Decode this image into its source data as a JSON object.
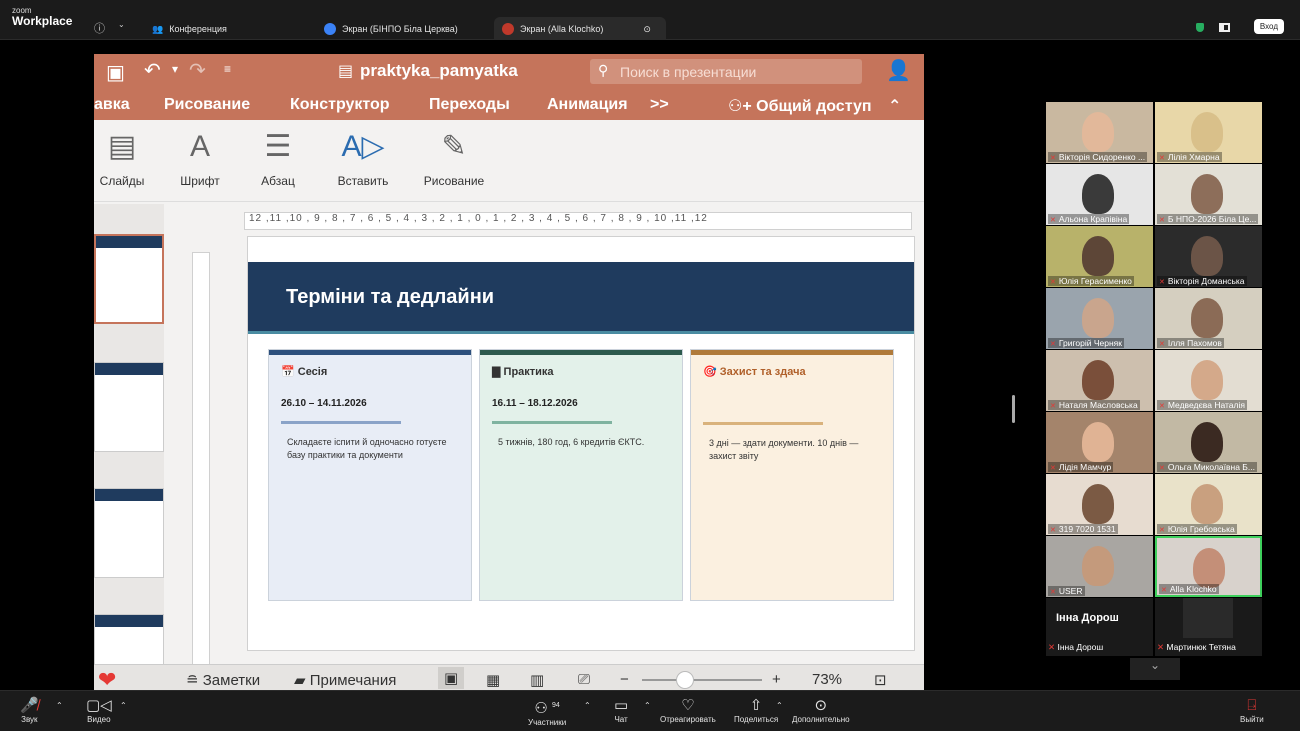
{
  "topbar": {
    "logo_small": "zoom",
    "logo_big": "Workplace",
    "tabs": [
      {
        "label": "Конференция"
      },
      {
        "label": "Экран (БІНПО Біла Церква)"
      },
      {
        "label": "Экран (Alla Klochko)"
      }
    ],
    "signin_label": "Вход"
  },
  "ppt": {
    "filename": "praktyka_pamyatka",
    "search_placeholder": "Поиск в презентации",
    "tabs": [
      "авка",
      "Рисование",
      "Конструктор",
      "Переходы",
      "Анимация",
      ">>"
    ],
    "share_label": "Общий доступ",
    "tools": [
      "Слайды",
      "Шрифт",
      "Абзац",
      "Вставить",
      "Рисование"
    ],
    "ruler_text": "12 ,11 ,10 , 9 , 8 , 7 , 6 , 5 , 4 , 3 , 2 , 1 , 0 , 1 , 2 , 3 , 4 , 5 , 6 , 7 , 8 , 9 , 10 ,11 ,12",
    "slide": {
      "title": "Терміни та дедлайни",
      "cards": [
        {
          "icon": "📅",
          "title": "Сесія",
          "dates": "26.10 – 14.11.2026",
          "text": "Складаєте іспити й одночасно готуєте базу практики та документи",
          "bar": "#2c4f7c",
          "bg": "#e8edf6",
          "line": "#8aa3c8"
        },
        {
          "icon": "▇",
          "title": "Практика",
          "dates": "16.11 – 18.12.2026",
          "text": "5 тижнів, 180 год, 6 кредитів ЄКТС.",
          "bar": "#2d5a4e",
          "bg": "#e3f1ea",
          "line": "#7fb3a0"
        },
        {
          "icon": "🎯",
          "title": "Захист та здача",
          "dates": "",
          "text": "3 дні — здати документи. 10 днів — захист звіту",
          "bar": "#b07a3a",
          "bg": "#fbf0e0",
          "line": "#d9b27c"
        }
      ]
    },
    "status": {
      "notes": "Заметки",
      "comments": "Примечания",
      "zoom": "73%"
    }
  },
  "participants": [
    {
      "name": "Вікторія Сидоренко ..."
    },
    {
      "name": "Лілія Хмарна"
    },
    {
      "name": "Альона Крапівіна"
    },
    {
      "name": "Б НПО-2026 Біла Це..."
    },
    {
      "name": "Юлія Герасименко"
    },
    {
      "name": "Вікторія Доманська"
    },
    {
      "name": "Григорій Черняк"
    },
    {
      "name": "Ілля Пахомов"
    },
    {
      "name": "Наталя Масловська"
    },
    {
      "name": "Медведєва Наталія"
    },
    {
      "name": "Лідія Мамчур"
    },
    {
      "name": "Ольга Миколаївна Б..."
    },
    {
      "name": "319 7020 1531"
    },
    {
      "name": "Юлія Гребовська"
    },
    {
      "name": "USER"
    },
    {
      "name": "Alla Klochko"
    }
  ],
  "participants_extra": {
    "big_name": "Інна Дорош",
    "names": [
      "Інна Дорош",
      "Мартинюк Тетяна"
    ]
  },
  "bottombar": {
    "audio": "Звук",
    "video": "Видео",
    "participants": "Участники",
    "participants_count": "94",
    "chat": "Чат",
    "react": "Отреагировать",
    "share": "Поделиться",
    "more": "Дополнительно",
    "leave": "Выйти"
  },
  "colors": {
    "ppt_accent": "#c5745b",
    "slide_header": "#1f3b5e",
    "danger": "#e53935",
    "active_speaker": "#3ecf5c"
  }
}
